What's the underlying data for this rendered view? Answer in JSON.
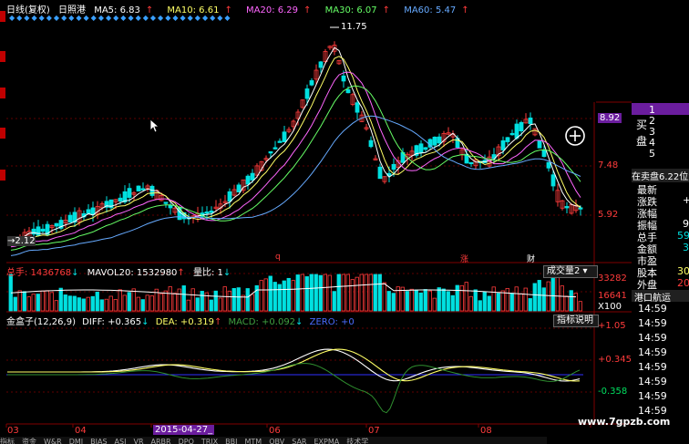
{
  "legend": {
    "title": "日线(复权)",
    "stock": "日照港",
    "ma5": "MA5: 6.83",
    "ma10": "MA10: 6.61",
    "ma20": "MA20: 6.29",
    "ma30": "MA30: 6.07",
    "ma60": "MA60: 5.47",
    "arrow": "↑"
  },
  "price_panel": {
    "high_marker": "11.75",
    "low_marker": "2.12",
    "axis_top": "8.92",
    "axis_mid": "7.48",
    "axis_low": "5.92",
    "event_marks": [
      "q",
      "涨",
      "财"
    ],
    "ma_colors": {
      "ma5": "#ffffff",
      "ma10": "#ffff66",
      "ma20": "#ff66ff",
      "ma30": "#66ff66",
      "ma60": "#66aaff"
    },
    "up_color": "#ff3b3b",
    "down_color": "#00e0e0"
  },
  "volume_panel": {
    "label_total": "总手: 1436768",
    "label_mavol20": "MAVOL20: 1532980",
    "label_ratio": "量比: 1",
    "tab": "成交量2",
    "axis_top": "33282",
    "axis_mid": "16641",
    "axis_unit": "X100"
  },
  "macd_panel": {
    "name": "金盒子(12,26,9)",
    "diff": "DIFF: +0.365",
    "dea": "DEA: +0.319",
    "macd": "MACD: +0.092",
    "zero": "ZERO: +0",
    "tab": "指标说明",
    "axis_top": "+1.05",
    "axis_mid": "+0.345",
    "axis_low": "-0.358"
  },
  "x_axis": {
    "months": [
      "03",
      "04",
      "05",
      "06",
      "07",
      "08"
    ],
    "highlight_date": "2015-04-27_"
  },
  "right_panel": {
    "price_tag": "8.92",
    "labels_top": [
      "1",
      "2",
      "3",
      "4",
      "5"
    ],
    "buy_label": "买",
    "sell_label": "盘",
    "mid_title": "在卖盘6.22位置",
    "rows": [
      {
        "label": "最新",
        "value": ""
      },
      {
        "label": "涨跌",
        "value": "+"
      },
      {
        "label": "涨幅",
        "value": ""
      },
      {
        "label": "振幅",
        "value": "9"
      },
      {
        "label": "总手",
        "value": "59"
      },
      {
        "label": "金额",
        "value": "3"
      },
      {
        "label": "市盈",
        "value": ""
      },
      {
        "label": "股本",
        "value": "30"
      },
      {
        "label": "外盘",
        "value": "20"
      }
    ],
    "section_title": "港口航运",
    "times": [
      "14:59",
      "14:59",
      "14:59",
      "14:59",
      "14:59",
      "14:59",
      "14:59",
      "14:59"
    ]
  },
  "bottom_tabs": [
    "指标",
    "资金",
    "W&R",
    "DMI",
    "BIAS",
    "ASI",
    "VR",
    "ARBR",
    "DPO",
    "TRIX",
    "BBI",
    "MTM",
    "OBV",
    "SAR",
    "EXPMA",
    "技术学"
  ],
  "watermark": "www.7gpzb.com"
}
